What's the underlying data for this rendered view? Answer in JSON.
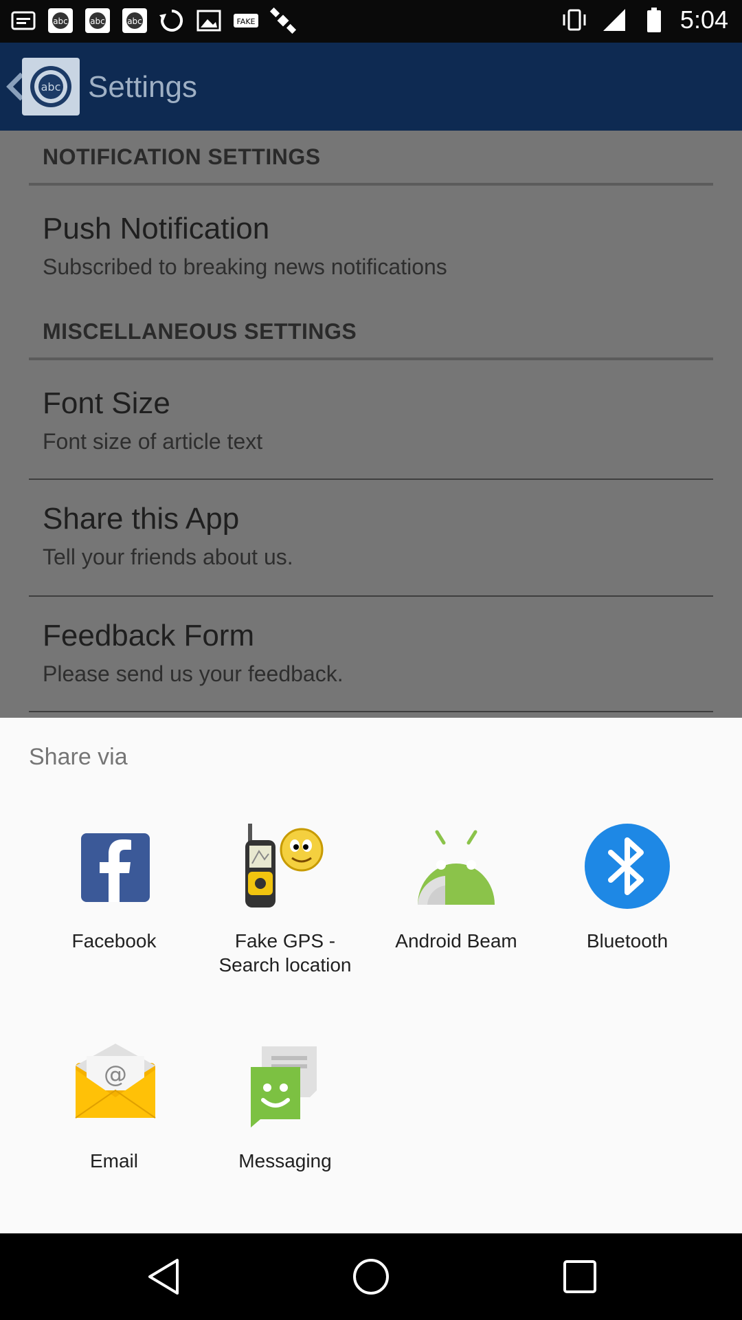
{
  "status_bar": {
    "time": "5:04",
    "left_icons": [
      "notification-icon",
      "abc-app-icon",
      "abc-app-icon",
      "abc-app-icon",
      "sync-icon",
      "image-icon",
      "fake-label-icon",
      "satellite-icon"
    ],
    "right_icons": [
      "vibrate-icon",
      "signal-icon",
      "battery-icon"
    ]
  },
  "app_bar": {
    "title": "Settings"
  },
  "settings": {
    "notification_header": "NOTIFICATION SETTINGS",
    "push_title": "Push Notification",
    "push_sub": "Subscribed to breaking news notifications",
    "misc_header": "MISCELLANEOUS SETTINGS",
    "font_title": "Font Size",
    "font_sub": "Font size of article text",
    "share_title": "Share this App",
    "share_sub": "Tell your friends about us.",
    "feedback_title": "Feedback Form",
    "feedback_sub": "Please send us your feedback."
  },
  "share_sheet": {
    "title": "Share via",
    "apps": [
      {
        "label": "Facebook",
        "icon": "facebook-icon"
      },
      {
        "label": "Fake GPS - Search location",
        "icon": "gps-device-icon"
      },
      {
        "label": "Android Beam",
        "icon": "android-beam-icon"
      },
      {
        "label": "Bluetooth",
        "icon": "bluetooth-icon"
      },
      {
        "label": "Email",
        "icon": "email-icon"
      },
      {
        "label": "Messaging",
        "icon": "messaging-icon"
      }
    ]
  },
  "colors": {
    "facebook_blue": "#3b5998",
    "android_green": "#8bc34a",
    "bluetooth_blue": "#1e88e5",
    "email_yellow": "#f5b100",
    "messaging_green": "#7cc142"
  }
}
